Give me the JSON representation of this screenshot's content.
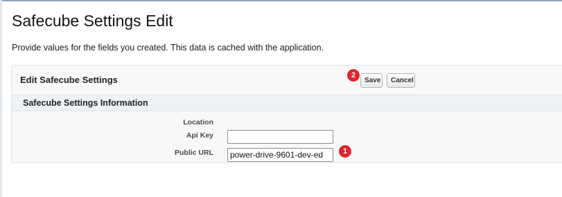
{
  "page": {
    "title": "Safecube Settings Edit",
    "description": "Provide values for the fields you created. This data is cached with the application."
  },
  "panel": {
    "title": "Edit Safecube Settings",
    "save_label": "Save",
    "cancel_label": "Cancel",
    "section_title": "Safecube Settings Information"
  },
  "fields": {
    "location_label": "Location",
    "api_key_label": "Api Key",
    "api_key_value": "",
    "public_url_label": "Public URL",
    "public_url_value": "power-drive-9601-dev-ed"
  },
  "annotations": {
    "step_1": "1",
    "step_2": "2"
  },
  "colors": {
    "badge": "#e0242f",
    "panel_background": "#f8f8f8",
    "section_bar": "#eef1f5"
  }
}
